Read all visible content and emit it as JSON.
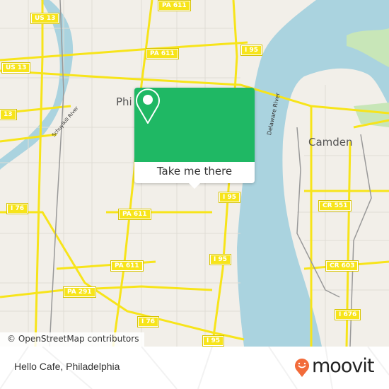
{
  "map": {
    "attribution": "© OpenStreetMap contributors",
    "colors": {
      "land": "#f2efe9",
      "water": "#aad3df",
      "park": "#c8e6b8",
      "road": "#f7e41a",
      "accent": "#1fb864"
    },
    "labels": {
      "city_philadelphia": "Phi",
      "city_camden": "Camden",
      "delaware_river": "Delaware River",
      "schuylkill_river": "Schuylkill River"
    },
    "shields": [
      "US 13",
      "PA 611",
      "PA 611",
      "I 95",
      "US 13",
      "13",
      "I 95",
      "PA 611",
      "I 76",
      "CR 551",
      "I 95",
      "PA 611",
      "CR 603",
      "PA 291",
      "I 76",
      "I 676",
      "I 95"
    ]
  },
  "popup": {
    "button_label": "Take me there",
    "icon": "location-pin-icon"
  },
  "footer": {
    "title": "Hello Cafe, Philadelphia",
    "brand": "moovit"
  }
}
